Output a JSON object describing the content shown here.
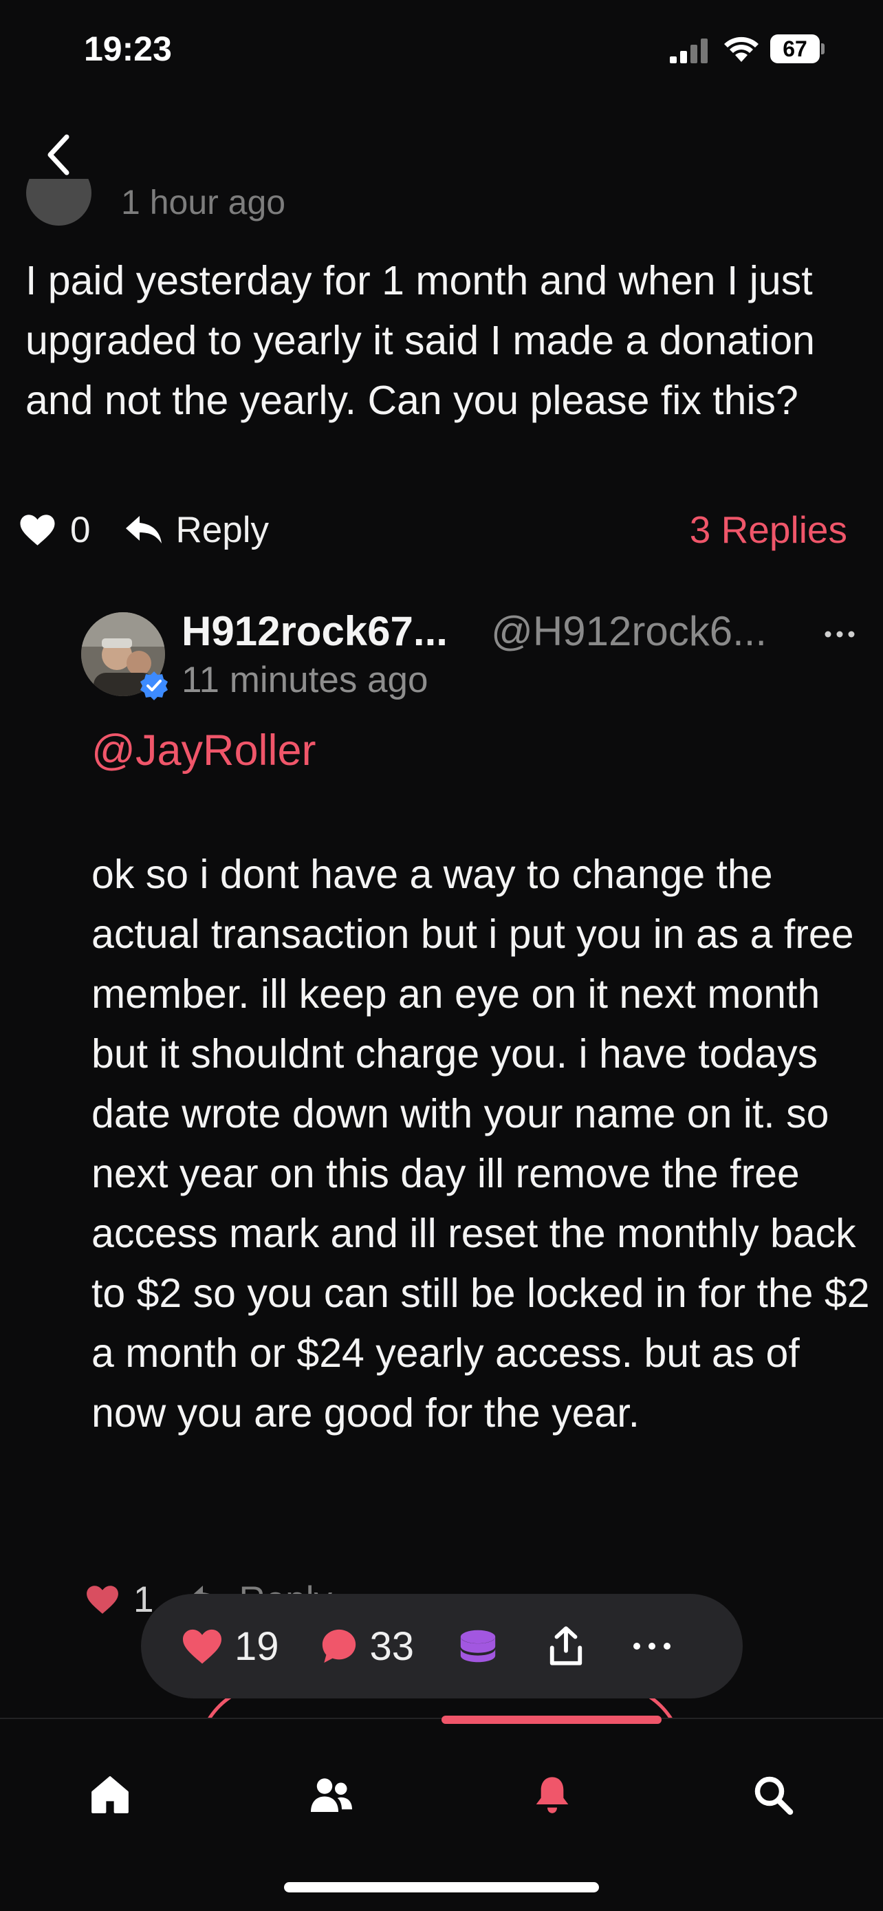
{
  "status_bar": {
    "time": "19:23",
    "battery": "67",
    "icons": [
      "cellular-signal-icon",
      "wifi-icon",
      "battery-icon"
    ]
  },
  "header": {
    "back_icon": "chevron-left-icon"
  },
  "parent_comment": {
    "time_partial": "1 hour ago",
    "text": "I paid yesterday for 1 month and when I just upgraded to yearly it said I made a donation and not the yearly. Can you please fix this?",
    "likes": "0",
    "reply_label": "Reply",
    "replies_count": "3 Replies"
  },
  "reply_comment": {
    "name": "H912rock67...",
    "handle": "@H912rock6...",
    "time": "11 minutes ago",
    "verified": true,
    "mention": "@JayRoller",
    "text": "ok so i dont have a way to change the actual transaction but i put you in as a free member. ill keep an eye on it next month but it shouldnt charge you. i have todays date wrote down with your name on it. so next year on this day ill remove the free access mark and ill reset the monthly back to $2 so you can still be locked in for the $2 a month or $24 yearly access. but as of now you are good for the year.",
    "likes": "1",
    "reply_label": "Reply"
  },
  "floating_actions": {
    "likes": "19",
    "comments": "33",
    "icons": [
      "heart-icon",
      "comment-icon",
      "coins-icon",
      "share-icon",
      "more-icon"
    ]
  },
  "tab_bar": {
    "tabs": [
      "home-icon",
      "people-icon",
      "bell-icon",
      "search-icon"
    ],
    "active_tab": "bell-icon"
  },
  "colors": {
    "accent": "#f0566a",
    "background": "#0b0b0c",
    "bar": "#262629",
    "coins": "#a257e0",
    "verified": "#3d8bff"
  }
}
